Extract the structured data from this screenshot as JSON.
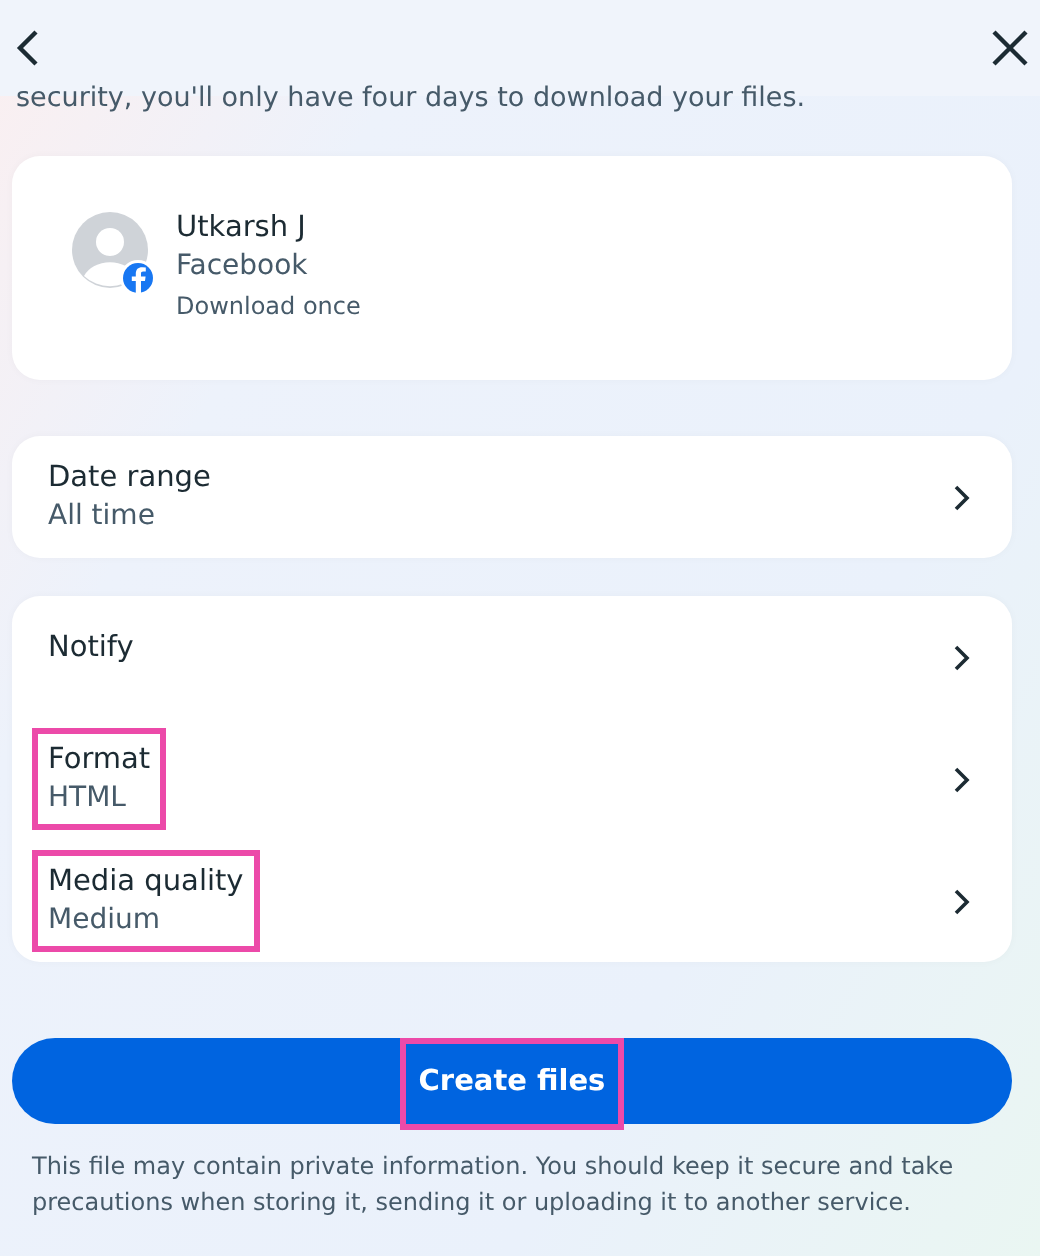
{
  "intro": "security, you'll only have four days to download your files.",
  "account": {
    "name": "Utkarsh J",
    "platform": "Facebook",
    "frequency": "Download once"
  },
  "settings_groups": [
    [
      {
        "title": "Date range",
        "value": "All time",
        "highlighted": false
      }
    ],
    [
      {
        "title": "Notify",
        "highlighted": false
      },
      {
        "title": "Format",
        "value": "HTML",
        "highlighted": true
      },
      {
        "title": "Media quality",
        "value": "Medium",
        "highlighted": true
      }
    ]
  ],
  "create_button": {
    "label": "Create files",
    "highlighted": true
  },
  "disclaimer": "This file may contain private information. You should keep it secure and take precautions when storing it, sending it or uploading it to another service."
}
